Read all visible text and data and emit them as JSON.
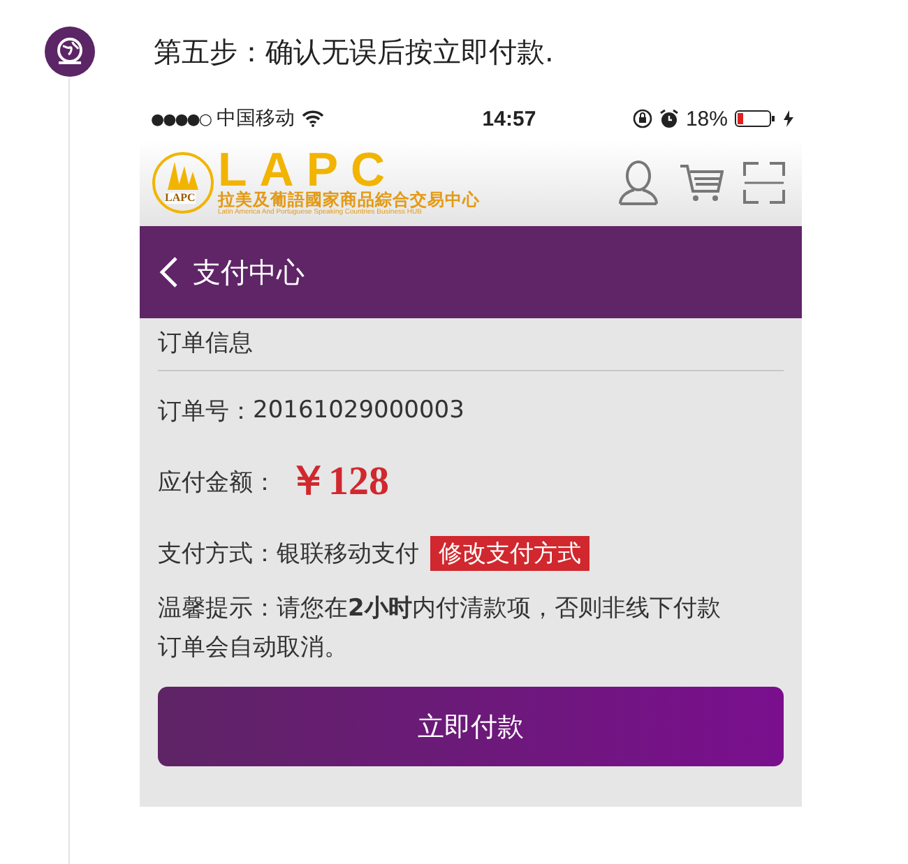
{
  "step": {
    "title": "第五步：确认无误后按立即付款."
  },
  "status_bar": {
    "signal": "●●●●○",
    "carrier": "中国移动",
    "time": "14:57",
    "battery": "18%"
  },
  "logo": {
    "badge": "LAPC",
    "letters": "LAPC",
    "name_cn": "拉美及葡語國家商品綜合交易中心",
    "name_en": "Latin America And Portuguese Speaking Countries Business HUB"
  },
  "nav": {
    "title": "支付中心"
  },
  "order": {
    "section_title": "订单信息",
    "number_label": "订单号：",
    "number": "20161029000003",
    "amount_label": "应付金额：",
    "amount": "￥128",
    "method_label": "支付方式：",
    "method": "银联移动支付",
    "change_button": "修改支付方式",
    "tip": "温馨提示：请您在**2小时**内付清款项，否则非线下付款订单会自动取消。"
  },
  "pay_button": "立即付款"
}
